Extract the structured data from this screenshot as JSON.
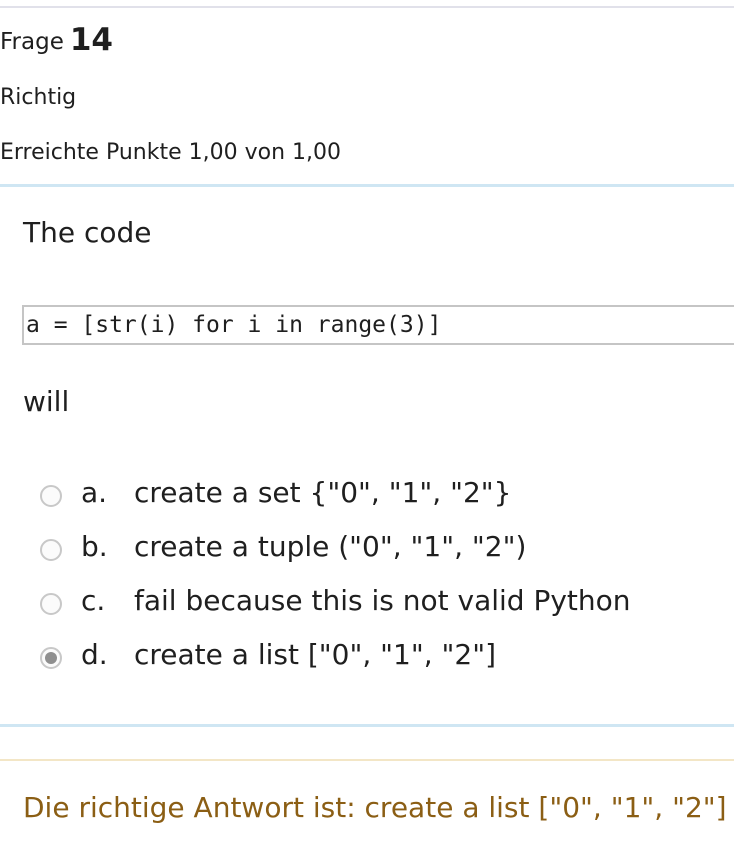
{
  "question_info": {
    "label": "Frage",
    "number": "14",
    "state": "Richtig",
    "grade": "Erreichte Punkte 1,00 von 1,00"
  },
  "question": {
    "intro": "The code",
    "code": "a = [str(i) for i in range(3)]",
    "outro": "will"
  },
  "answers": [
    {
      "letter": "a.",
      "text": "create a set {\"0\", \"1\", \"2\"}",
      "selected": false
    },
    {
      "letter": "b.",
      "text": "create a tuple (\"0\", \"1\", \"2\")",
      "selected": false
    },
    {
      "letter": "c.",
      "text": "fail because this is not valid Python",
      "selected": false
    },
    {
      "letter": "d.",
      "text": "create a list [\"0\", \"1\", \"2\"]",
      "selected": true
    }
  ],
  "feedback": {
    "right_answer": "Die richtige Antwort ist: create a list [\"0\", \"1\", \"2\"]"
  },
  "colors": {
    "divider": "#cfe6f3",
    "feedback_divider": "#f3e6c6",
    "feedback_text": "#8b5e14",
    "radio_border": "#c8c8c8",
    "radio_selected": "#8f8f8f"
  },
  "icons": {
    "radio_unchecked": "radio-unchecked-icon",
    "radio_checked": "radio-checked-icon"
  }
}
